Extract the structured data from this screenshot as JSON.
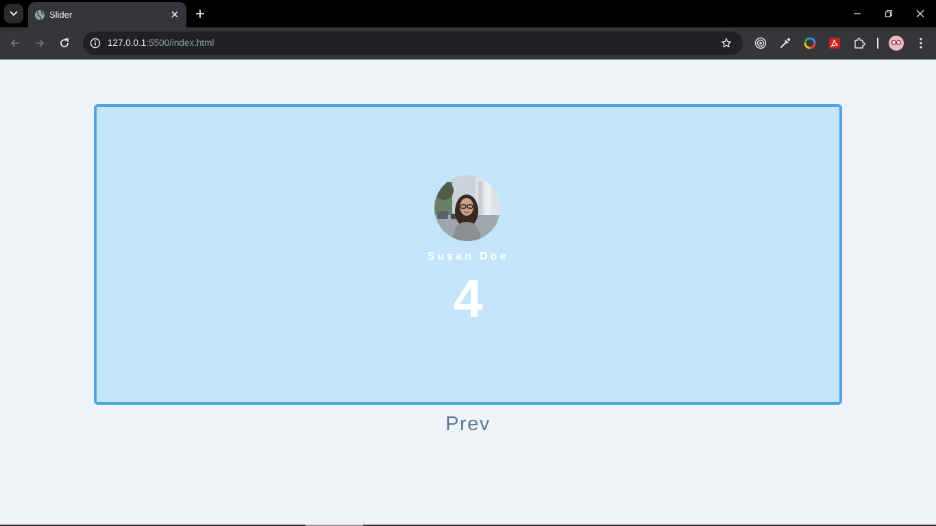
{
  "browser": {
    "tab_title": "Slider",
    "url_host": "127.0.0.1",
    "url_rest": ":5500/index.html",
    "icons": [
      "tab-search-icon",
      "globe-icon",
      "close-icon",
      "plus-icon",
      "minimize-icon",
      "restore-icon",
      "window-close-icon",
      "back-arrow-icon",
      "forward-arrow-icon",
      "reload-icon",
      "site-info-icon",
      "star-icon",
      "target-extension-icon",
      "eyedropper-icon",
      "color-ring-extension-icon",
      "pdf-extension-icon",
      "puzzle-icon",
      "profile-avatar-icon",
      "kebab-menu-icon"
    ]
  },
  "slide": {
    "name": "Susan Doe",
    "number": "4"
  },
  "controls": {
    "prev_label": "Prev"
  },
  "colors": {
    "page_bg": "#f0f4f8",
    "card_bg": "#c3e4fa",
    "card_border": "#4ca6e0",
    "prev_text": "#5a7a96"
  }
}
